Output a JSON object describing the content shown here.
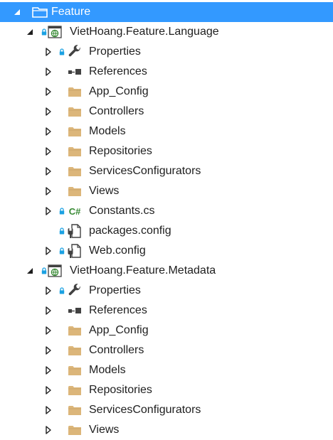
{
  "tree": {
    "root": {
      "label": "Feature"
    },
    "projects": [
      {
        "name": "VietHoang.Feature.Language",
        "items": [
          {
            "label": "Properties",
            "icon": "wrench-icon",
            "kind": "properties"
          },
          {
            "label": "References",
            "icon": "references-icon",
            "kind": "references"
          },
          {
            "label": "App_Config",
            "icon": "folder-icon",
            "kind": "folder"
          },
          {
            "label": "Controllers",
            "icon": "folder-icon",
            "kind": "folder"
          },
          {
            "label": "Models",
            "icon": "folder-icon",
            "kind": "folder"
          },
          {
            "label": "Repositories",
            "icon": "folder-icon",
            "kind": "folder"
          },
          {
            "label": "ServicesConfigurators",
            "icon": "folder-icon",
            "kind": "folder"
          },
          {
            "label": "Views",
            "icon": "folder-icon",
            "kind": "folder"
          },
          {
            "label": "Constants.cs",
            "icon": "csharp-file-icon",
            "kind": "csfile",
            "csLabel": "C#"
          },
          {
            "label": "packages.config",
            "icon": "config-file-icon",
            "kind": "config"
          },
          {
            "label": "Web.config",
            "icon": "config-file-icon",
            "kind": "webconfig"
          }
        ]
      },
      {
        "name": "VietHoang.Feature.Metadata",
        "items": [
          {
            "label": "Properties",
            "icon": "wrench-icon",
            "kind": "properties"
          },
          {
            "label": "References",
            "icon": "references-icon",
            "kind": "references"
          },
          {
            "label": "App_Config",
            "icon": "folder-icon",
            "kind": "folder"
          },
          {
            "label": "Controllers",
            "icon": "folder-icon",
            "kind": "folder"
          },
          {
            "label": "Models",
            "icon": "folder-icon",
            "kind": "folder"
          },
          {
            "label": "Repositories",
            "icon": "folder-icon",
            "kind": "folder"
          },
          {
            "label": "ServicesConfigurators",
            "icon": "folder-icon",
            "kind": "folder"
          },
          {
            "label": "Views",
            "icon": "folder-icon",
            "kind": "folder"
          }
        ]
      }
    ]
  },
  "colors": {
    "selection": "#3399ff",
    "folder": "#dcb67a",
    "lock": "#1ba1e2",
    "csharp": "#388a34",
    "text": "#1e1e1e"
  }
}
